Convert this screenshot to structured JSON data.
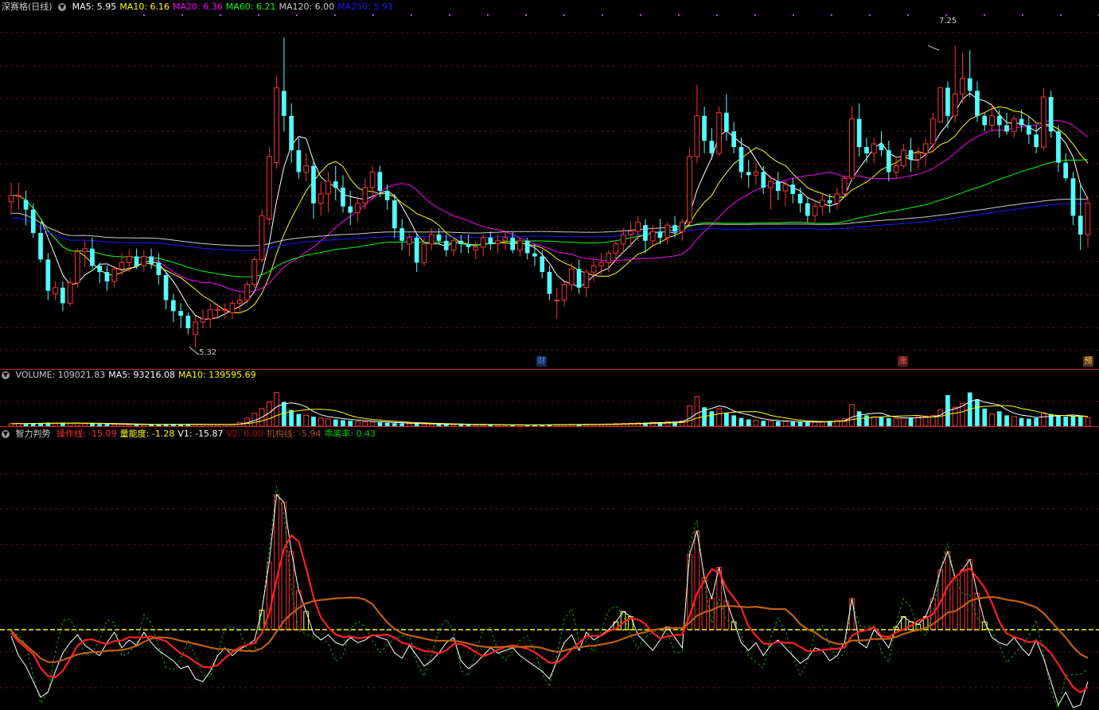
{
  "price_header": {
    "name": "深赛格(日线)",
    "items": [
      {
        "label": "MA5: 5.95",
        "color": "#ffffff"
      },
      {
        "label": "MA10: 6.16",
        "color": "#ffff00"
      },
      {
        "label": "MA20: 6.36",
        "color": "#ff00ff"
      },
      {
        "label": "MA60: 6.21",
        "color": "#00ff00"
      },
      {
        "label": "MA120: 6.00",
        "color": "#cccccc"
      },
      {
        "label": "MA250: 5.93",
        "color": "#1a1aff"
      }
    ]
  },
  "volume_header": {
    "items": [
      {
        "label": "VOLUME: 109021.83",
        "color": "#cccccc"
      },
      {
        "label": "MA5: 93216.08",
        "color": "#ffffff"
      },
      {
        "label": "MA10: 139595.69",
        "color": "#ffff00"
      }
    ]
  },
  "indicator_header": {
    "name": "智力判势",
    "items": [
      {
        "label": "操作线: -15.09",
        "color": "#ff3030"
      },
      {
        "label": "量能度: -1.28",
        "color": "#ffff00"
      },
      {
        "label": "V1: -15.87",
        "color": "#ffffff"
      },
      {
        "label": "V2: 0.00",
        "color": "#cc0000"
      },
      {
        "label": "机构线: -5.94",
        "color": "#b05020"
      },
      {
        "label": "乖离率: 0.43",
        "color": "#00cc00"
      }
    ]
  },
  "price_extremes": {
    "high": "7.25",
    "low": "5.32"
  },
  "markers": [
    {
      "text": "财",
      "color": "#4a8ce0",
      "bg": "#1a2a5a"
    },
    {
      "text": "涨",
      "color": "#ff6060",
      "bg": "#5a1a1a"
    },
    {
      "text": "预",
      "color": "#ffcc66",
      "bg": "#5a3a1a"
    }
  ],
  "colors": {
    "up": "#ff3232",
    "down": "#54ffff",
    "grid": "#7a1a1a",
    "separator": "#c03030"
  },
  "chart_data": {
    "type": "candlestick",
    "dates": [],
    "price": {
      "ylim": [
        5.2,
        7.45
      ],
      "ohlc": [
        [
          6.25,
          6.37,
          6.17,
          6.29
        ],
        [
          6.29,
          6.37,
          6.2,
          6.29
        ],
        [
          6.26,
          6.32,
          6.1,
          6.2
        ],
        [
          6.2,
          6.24,
          6.02,
          6.05
        ],
        [
          6.05,
          6.12,
          5.86,
          5.88
        ],
        [
          5.88,
          5.92,
          5.62,
          5.68
        ],
        [
          5.66,
          5.74,
          5.62,
          5.7
        ],
        [
          5.7,
          5.74,
          5.55,
          5.6
        ],
        [
          5.6,
          5.76,
          5.58,
          5.73
        ],
        [
          5.73,
          5.95,
          5.7,
          5.93
        ],
        [
          5.93,
          6.0,
          5.83,
          5.95
        ],
        [
          5.95,
          6.02,
          5.82,
          5.84
        ],
        [
          5.84,
          5.86,
          5.73,
          5.8
        ],
        [
          5.8,
          5.84,
          5.68,
          5.74
        ],
        [
          5.74,
          5.84,
          5.7,
          5.82
        ],
        [
          5.82,
          5.92,
          5.78,
          5.86
        ],
        [
          5.86,
          5.94,
          5.8,
          5.9
        ],
        [
          5.9,
          5.95,
          5.82,
          5.84
        ],
        [
          5.84,
          5.94,
          5.8,
          5.9
        ],
        [
          5.9,
          5.95,
          5.82,
          5.85
        ],
        [
          5.86,
          5.92,
          5.72,
          5.78
        ],
        [
          5.78,
          5.8,
          5.56,
          5.62
        ],
        [
          5.62,
          5.66,
          5.48,
          5.55
        ],
        [
          5.55,
          5.6,
          5.44,
          5.52
        ],
        [
          5.52,
          5.54,
          5.4,
          5.44
        ],
        [
          5.4,
          5.52,
          5.32,
          5.48
        ],
        [
          5.48,
          5.56,
          5.44,
          5.5
        ],
        [
          5.5,
          5.6,
          5.44,
          5.56
        ],
        [
          5.56,
          5.6,
          5.5,
          5.56
        ],
        [
          5.56,
          5.6,
          5.5,
          5.56
        ],
        [
          5.54,
          5.62,
          5.5,
          5.6
        ],
        [
          5.6,
          5.66,
          5.54,
          5.62
        ],
        [
          5.62,
          5.74,
          5.6,
          5.72
        ],
        [
          5.72,
          5.9,
          5.7,
          5.88
        ],
        [
          5.88,
          6.2,
          5.86,
          6.16
        ],
        [
          6.14,
          6.6,
          6.1,
          6.54
        ],
        [
          6.5,
          7.06,
          6.46,
          6.98
        ],
        [
          6.96,
          7.3,
          6.7,
          6.8
        ],
        [
          6.8,
          6.88,
          6.5,
          6.58
        ],
        [
          6.58,
          6.66,
          6.4,
          6.44
        ],
        [
          6.44,
          6.56,
          6.38,
          6.48
        ],
        [
          6.48,
          6.52,
          6.14,
          6.24
        ],
        [
          6.24,
          6.38,
          6.16,
          6.3
        ],
        [
          6.3,
          6.44,
          6.18,
          6.38
        ],
        [
          6.38,
          6.48,
          6.26,
          6.34
        ],
        [
          6.34,
          6.42,
          6.18,
          6.22
        ],
        [
          6.22,
          6.32,
          6.1,
          6.18
        ],
        [
          6.18,
          6.28,
          6.12,
          6.24
        ],
        [
          6.24,
          6.4,
          6.2,
          6.34
        ],
        [
          6.34,
          6.48,
          6.26,
          6.44
        ],
        [
          6.44,
          6.48,
          6.28,
          6.32
        ],
        [
          6.32,
          6.36,
          6.2,
          6.26
        ],
        [
          6.26,
          6.3,
          6.02,
          6.08
        ],
        [
          6.08,
          6.14,
          5.94,
          6.0
        ],
        [
          5.98,
          6.04,
          5.9,
          6.02
        ],
        [
          6.02,
          6.04,
          5.8,
          5.86
        ],
        [
          5.86,
          6.02,
          5.84,
          5.98
        ],
        [
          5.98,
          6.08,
          5.94,
          6.04
        ],
        [
          6.04,
          6.08,
          5.98,
          6.0
        ],
        [
          6.0,
          6.04,
          5.9,
          5.94
        ],
        [
          5.94,
          6.02,
          5.9,
          6.0
        ],
        [
          6.0,
          6.04,
          5.92,
          5.98
        ],
        [
          5.98,
          6.04,
          5.92,
          5.96
        ],
        [
          5.94,
          6.0,
          5.88,
          5.96
        ],
        [
          5.96,
          6.04,
          5.9,
          6.02
        ],
        [
          6.02,
          6.06,
          5.94,
          5.98
        ],
        [
          5.98,
          6.04,
          5.92,
          6.0
        ],
        [
          6.0,
          6.06,
          5.94,
          6.02
        ],
        [
          6.02,
          6.06,
          5.92,
          5.94
        ],
        [
          5.94,
          6.02,
          5.9,
          6.0
        ],
        [
          6.0,
          6.02,
          5.88,
          5.92
        ],
        [
          5.92,
          5.98,
          5.84,
          5.9
        ],
        [
          5.9,
          5.94,
          5.76,
          5.8
        ],
        [
          5.8,
          5.84,
          5.62,
          5.66
        ],
        [
          5.62,
          5.7,
          5.5,
          5.62
        ],
        [
          5.62,
          5.74,
          5.58,
          5.72
        ],
        [
          5.72,
          5.86,
          5.68,
          5.82
        ],
        [
          5.82,
          5.88,
          5.66,
          5.7
        ],
        [
          5.7,
          5.82,
          5.64,
          5.8
        ],
        [
          5.8,
          5.88,
          5.74,
          5.84
        ],
        [
          5.84,
          5.92,
          5.78,
          5.86
        ],
        [
          5.86,
          5.94,
          5.8,
          5.92
        ],
        [
          5.92,
          6.0,
          5.86,
          5.98
        ],
        [
          5.98,
          6.08,
          5.92,
          6.04
        ],
        [
          6.04,
          6.12,
          5.96,
          6.06
        ],
        [
          6.06,
          6.16,
          6.0,
          6.12
        ],
        [
          6.1,
          6.14,
          5.92,
          6.0
        ],
        [
          6.0,
          6.1,
          5.96,
          6.06
        ],
        [
          6.06,
          6.14,
          5.98,
          6.02
        ],
        [
          6.02,
          6.12,
          5.98,
          6.1
        ],
        [
          6.1,
          6.16,
          6.02,
          6.06
        ],
        [
          6.06,
          6.14,
          6.0,
          6.12
        ],
        [
          6.12,
          6.6,
          6.1,
          6.54
        ],
        [
          6.54,
          7.0,
          6.5,
          6.8
        ],
        [
          6.8,
          6.86,
          6.56,
          6.64
        ],
        [
          6.64,
          6.72,
          6.52,
          6.56
        ],
        [
          6.56,
          6.86,
          6.54,
          6.82
        ],
        [
          6.82,
          6.94,
          6.64,
          6.7
        ],
        [
          6.7,
          6.76,
          6.56,
          6.6
        ],
        [
          6.6,
          6.66,
          6.4,
          6.44
        ],
        [
          6.44,
          6.52,
          6.34,
          6.42
        ],
        [
          6.42,
          6.5,
          6.36,
          6.44
        ],
        [
          6.44,
          6.48,
          6.3,
          6.34
        ],
        [
          6.34,
          6.42,
          6.2,
          6.38
        ],
        [
          6.38,
          6.44,
          6.26,
          6.32
        ],
        [
          6.32,
          6.38,
          6.22,
          6.36
        ],
        [
          6.36,
          6.4,
          6.24,
          6.3
        ],
        [
          6.3,
          6.34,
          6.18,
          6.24
        ],
        [
          6.24,
          6.28,
          6.12,
          6.16
        ],
        [
          6.16,
          6.26,
          6.12,
          6.22
        ],
        [
          6.22,
          6.3,
          6.16,
          6.26
        ],
        [
          6.26,
          6.3,
          6.18,
          6.24
        ],
        [
          6.24,
          6.34,
          6.2,
          6.3
        ],
        [
          6.3,
          6.42,
          6.28,
          6.4
        ],
        [
          6.4,
          6.86,
          6.38,
          6.78
        ],
        [
          6.78,
          6.88,
          6.54,
          6.6
        ],
        [
          6.6,
          6.66,
          6.5,
          6.56
        ],
        [
          6.56,
          6.66,
          6.5,
          6.62
        ],
        [
          6.62,
          6.7,
          6.54,
          6.58
        ],
        [
          6.58,
          6.64,
          6.38,
          6.44
        ],
        [
          6.44,
          6.54,
          6.4,
          6.48
        ],
        [
          6.48,
          6.62,
          6.46,
          6.58
        ],
        [
          6.58,
          6.66,
          6.44,
          6.52
        ],
        [
          6.52,
          6.6,
          6.46,
          6.56
        ],
        [
          6.56,
          6.66,
          6.48,
          6.62
        ],
        [
          6.62,
          6.82,
          6.56,
          6.78
        ],
        [
          6.76,
          6.98,
          6.76,
          6.98
        ],
        [
          6.98,
          7.02,
          6.72,
          6.8
        ],
        [
          6.8,
          7.25,
          6.76,
          6.94
        ],
        [
          6.94,
          7.2,
          6.88,
          7.04
        ],
        [
          7.04,
          7.22,
          6.92,
          6.96
        ],
        [
          6.96,
          7.02,
          6.76,
          6.8
        ],
        [
          6.8,
          6.82,
          6.7,
          6.74
        ],
        [
          6.74,
          6.88,
          6.7,
          6.8
        ],
        [
          6.8,
          6.84,
          6.66,
          6.74
        ],
        [
          6.74,
          6.82,
          6.68,
          6.7
        ],
        [
          6.7,
          6.8,
          6.66,
          6.78
        ],
        [
          6.78,
          6.84,
          6.7,
          6.74
        ],
        [
          6.74,
          6.8,
          6.62,
          6.68
        ],
        [
          6.68,
          6.74,
          6.56,
          6.6
        ],
        [
          6.6,
          6.98,
          6.58,
          6.92
        ],
        [
          6.92,
          6.96,
          6.66,
          6.7
        ],
        [
          6.7,
          6.74,
          6.44,
          6.5
        ],
        [
          6.5,
          6.56,
          6.38,
          6.4
        ],
        [
          6.4,
          6.44,
          6.1,
          6.16
        ],
        [
          6.16,
          6.36,
          5.94,
          6.04
        ],
        [
          6.04,
          6.28,
          5.96,
          6.24
        ]
      ],
      "ma": [
        {
          "name": "MA5",
          "color": "#ffffff",
          "period": 5
        },
        {
          "name": "MA10",
          "color": "#ffff00",
          "period": 10
        },
        {
          "name": "MA20",
          "color": "#ff00ff",
          "period": 20
        },
        {
          "name": "MA60",
          "color": "#00ff00",
          "period": 60
        },
        {
          "name": "MA120",
          "color": "#cccccc",
          "period": 120
        },
        {
          "name": "MA250",
          "color": "#1a1aff",
          "period": 250
        }
      ]
    },
    "volume": {
      "ylim": [
        0,
        330000
      ],
      "values": [
        18000,
        21000,
        19000,
        22000,
        24000,
        26000,
        20000,
        24000,
        22000,
        23000,
        18000,
        20000,
        16000,
        15000,
        14000,
        13000,
        12000,
        12000,
        11000,
        12000,
        13000,
        14000,
        15000,
        15000,
        14000,
        13000,
        12000,
        11000,
        11000,
        12000,
        15000,
        28000,
        60000,
        95000,
        130000,
        180000,
        250000,
        180000,
        120000,
        90000,
        80000,
        70000,
        60000,
        55000,
        50000,
        45000,
        40000,
        35000,
        32000,
        30000,
        28000,
        25000,
        22000,
        20000,
        18000,
        17000,
        16000,
        15000,
        14000,
        13000,
        12000,
        11000,
        11000,
        10000,
        10000,
        10000,
        9000,
        9000,
        9000,
        9000,
        9000,
        10000,
        10000,
        11000,
        12000,
        12000,
        13000,
        13000,
        14000,
        14000,
        15000,
        16000,
        18000,
        20000,
        22000,
        24000,
        26000,
        28000,
        30000,
        32000,
        34000,
        40000,
        150000,
        220000,
        140000,
        110000,
        130000,
        100000,
        80000,
        60000,
        50000,
        45000,
        40000,
        38000,
        36000,
        34000,
        32000,
        30000,
        28000,
        30000,
        34000,
        40000,
        45000,
        55000,
        160000,
        110000,
        80000,
        70000,
        65000,
        60000,
        55000,
        60000,
        65000,
        70000,
        75000,
        80000,
        120000,
        230000,
        140000,
        170000,
        250000,
        200000,
        130000,
        90000,
        110000,
        80000,
        70000,
        60000,
        55000,
        60000,
        100000,
        90000,
        80000,
        70000,
        75000,
        70000,
        65000
      ],
      "ma": [
        {
          "name": "MA5",
          "color": "#ffffff",
          "period": 5
        },
        {
          "name": "MA10",
          "color": "#ffff00",
          "period": 10
        }
      ]
    },
    "indicator": {
      "ylim": [
        -60,
        145
      ],
      "v1": [
        -5,
        -20,
        -28,
        -40,
        -52,
        -48,
        -32,
        -18,
        -10,
        -4,
        -12,
        -16,
        -20,
        -10,
        -2,
        -14,
        -8,
        -12,
        -2,
        -10,
        -16,
        -20,
        -24,
        -30,
        -28,
        -38,
        -40,
        -32,
        -20,
        -14,
        -20,
        -15,
        -12,
        -8,
        15,
        52,
        104,
        98,
        60,
        30,
        14,
        -3,
        -8,
        -4,
        -10,
        -12,
        -6,
        -10,
        -8,
        -4,
        -6,
        -8,
        -18,
        -22,
        -12,
        -20,
        -28,
        -24,
        -18,
        -10,
        -6,
        -24,
        -30,
        -26,
        -20,
        -14,
        -18,
        -16,
        -14,
        -20,
        -24,
        -28,
        -32,
        -38,
        -24,
        -10,
        -4,
        -16,
        -2,
        -8,
        -4,
        0,
        6,
        14,
        10,
        -4,
        -10,
        -16,
        -8,
        2,
        -6,
        -14,
        58,
        76,
        40,
        24,
        48,
        22,
        6,
        -10,
        -16,
        -10,
        -20,
        -12,
        -8,
        -14,
        -20,
        -26,
        -22,
        -14,
        -16,
        -24,
        -20,
        -10,
        24,
        -10,
        -14,
        0,
        -6,
        -14,
        2,
        10,
        6,
        4,
        10,
        24,
        46,
        60,
        40,
        46,
        54,
        28,
        6,
        -6,
        -10,
        -12,
        -6,
        -14,
        -20,
        -8,
        -22,
        -40,
        -58,
        -48,
        -60,
        -58,
        -40
      ]
    },
    "legend": [
      "操作线: -15.09",
      "量能度: -1.28",
      "V1: -15.87",
      "V2: 0.00",
      "机构线: -5.94",
      "乖离率: 0.43"
    ]
  }
}
